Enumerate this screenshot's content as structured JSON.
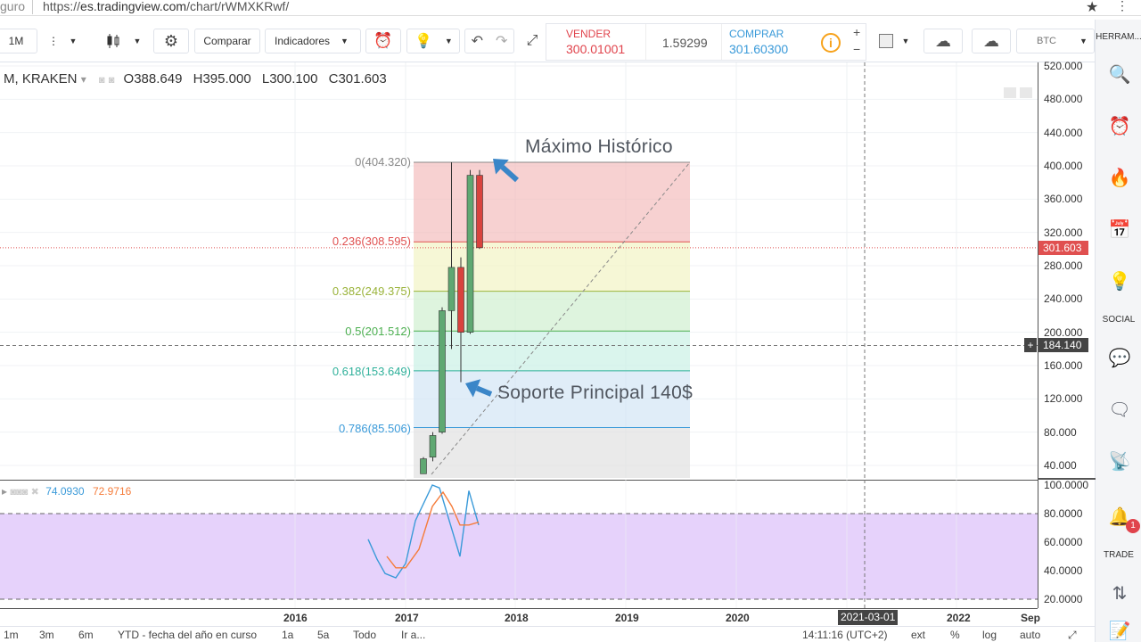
{
  "browser": {
    "site_fragment": "guro",
    "url_prefix": "https://",
    "url_host": "es.tradingview.com",
    "url_path": "/chart/rWMXKRwf/"
  },
  "toolbar": {
    "interval": "1M",
    "compare_label": "Comparar",
    "indicators_label": "Indicadores",
    "sell_label": "VENDER",
    "sell_price": "300.01001",
    "spread": "1.59299",
    "buy_label": "COMPRAR",
    "buy_price": "301.60300",
    "currency": "BTC"
  },
  "sidebar": {
    "head_tools": "HERRAM...",
    "head_social": "SOCIAL",
    "head_trade": "TRADE",
    "alert_badge": "1"
  },
  "legend": {
    "symbol": "M, KRAKEN",
    "o_label": "O",
    "o_value": "388.649",
    "h_label": "H",
    "h_value": "395.000",
    "l_label": "L",
    "l_value": "300.100",
    "c_label": "C",
    "c_value": "301.603"
  },
  "indicator_legend": {
    "value1": "74.0930",
    "value2": "72.9716"
  },
  "fib_levels": [
    {
      "label": "0(404.320)",
      "color": "#888888"
    },
    {
      "label": "0.236(308.595)",
      "color": "#e05050"
    },
    {
      "label": "0.382(249.375)",
      "color": "#9ab33a"
    },
    {
      "label": "0.5(201.512)",
      "color": "#4caf50"
    },
    {
      "label": "0.618(153.649)",
      "color": "#2fb09a"
    },
    {
      "label": "0.786(85.506)",
      "color": "#3a9ad9"
    }
  ],
  "annotations": {
    "ath": "Máximo Histórico",
    "support": "Soporte Principal 140$"
  },
  "price_axis": [
    "520.000",
    "480.000",
    "440.000",
    "400.000",
    "360.000",
    "320.000",
    "280.000",
    "240.000",
    "200.000",
    "160.000",
    "120.000",
    "80.000",
    "40.000"
  ],
  "price_current": "301.603",
  "price_cursor": "184.140",
  "ind_axis": [
    "100.0000",
    "80.0000",
    "60.0000",
    "40.0000",
    "20.0000"
  ],
  "time_axis": [
    "2016",
    "2017",
    "2018",
    "2019",
    "2020",
    "2021-03-01",
    "2022",
    "Sep"
  ],
  "bottom": {
    "ranges": [
      "1m",
      "3m",
      "6m",
      "YTD - fecha del año en curso",
      "1a",
      "5a",
      "Todo",
      "Ir a..."
    ],
    "clock": "14:11:16 (UTC+2)",
    "opts": [
      "ext",
      "%",
      "log",
      "auto"
    ]
  },
  "chart_data": {
    "type": "candlestick",
    "symbol": "M, KRAKEN",
    "x_unit": "month",
    "candles": [
      {
        "open": 30,
        "high": 50,
        "low": 30,
        "close": 48
      },
      {
        "open": 50,
        "high": 80,
        "low": 45,
        "close": 76
      },
      {
        "open": 80,
        "high": 230,
        "low": 78,
        "close": 226
      },
      {
        "open": 226,
        "high": 404.32,
        "low": 180,
        "close": 278
      },
      {
        "open": 278,
        "high": 290,
        "low": 140,
        "close": 200
      },
      {
        "open": 200,
        "high": 395,
        "low": 198,
        "close": 388.649
      },
      {
        "open": 388.649,
        "high": 395,
        "low": 300.1,
        "close": 301.603
      }
    ],
    "ylim": [
      20,
      530
    ],
    "colors": {
      "up": "#5fa872",
      "down": "#d9433e"
    },
    "stoch": {
      "k": [
        62,
        48,
        38,
        35,
        45,
        75,
        100,
        98,
        75,
        50,
        96,
        72
      ],
      "d": [
        50,
        42,
        42,
        55,
        85,
        95,
        85,
        72,
        72,
        74
      ]
    }
  }
}
